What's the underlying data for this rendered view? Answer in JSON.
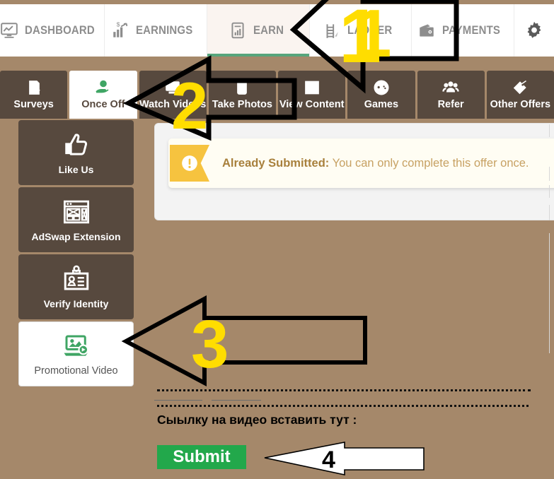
{
  "theme": {
    "page_bg": "#a5886a",
    "nav_bg": "#ffffff",
    "tab_active_bg": "#faf4f0",
    "tab_accent": "#56a57c",
    "subnav_bg": "#57493e",
    "sidebar_bg": "#57493e",
    "panel_bg": "#f3f3f3",
    "alert_bg": "#fffdf3",
    "alert_flag": "#f6c33f",
    "alert_title_color": "#a8803c",
    "alert_body_color": "#c7a163",
    "submit_bg": "#22a84b",
    "annotation_number_color": "#ffdd00",
    "annotation_outline_color": "#000000"
  },
  "topnav": {
    "items": [
      {
        "label": "DASHBOARD",
        "icon": "dashboard-chart-icon",
        "active": false
      },
      {
        "label": "EARNINGS",
        "icon": "earnings-bar-chart-icon",
        "active": false
      },
      {
        "label": "EARN",
        "icon": "earn-document-icon",
        "active": true
      },
      {
        "label": "LADDER",
        "icon": "ladder-icon",
        "active": false
      },
      {
        "label": "PAYMENTS",
        "icon": "wallet-icon",
        "active": false
      },
      {
        "label": "",
        "icon": "gear-icon",
        "active": false
      }
    ]
  },
  "subnav": {
    "items": [
      {
        "label": "Surveys",
        "icon": "survey-clipboard-icon",
        "active": false
      },
      {
        "label": "Once Off",
        "icon": "hand-coin-icon",
        "active": true
      },
      {
        "label": "Watch Videos",
        "icon": "watch-videos-icon",
        "active": false
      },
      {
        "label": "Take Photos",
        "icon": "camera-photo-icon",
        "active": false
      },
      {
        "label": "View Content",
        "icon": "view-content-icon",
        "active": false
      },
      {
        "label": "Games",
        "icon": "gamepad-icon",
        "active": false
      },
      {
        "label": "Refer",
        "icon": "people-group-icon",
        "active": false
      },
      {
        "label": "Other Offers",
        "icon": "price-tag-icon",
        "active": false
      }
    ]
  },
  "sidebar": {
    "items": [
      {
        "label": "Like Us",
        "icon": "thumbs-up-icon",
        "active": false
      },
      {
        "label": "AdSwap Extension",
        "icon": "browser-window-icon",
        "active": false
      },
      {
        "label": "Verify Identity",
        "icon": "id-badge-icon",
        "active": false
      },
      {
        "label": "Promotional Video",
        "icon": "video-laptop-icon",
        "active": true
      }
    ]
  },
  "alert": {
    "icon": "exclamation-circle-icon",
    "title": "Already Submitted:",
    "message": "You can only complete this offer once."
  },
  "form": {
    "label": "Сыылку на видео вставить тут :",
    "submit_label": "Submit"
  },
  "annotations": [
    {
      "number": "1",
      "style": "thick-outline",
      "number_color": "#ffdd00"
    },
    {
      "number": "2",
      "style": "thick-outline",
      "number_color": "#ffdd00"
    },
    {
      "number": "3",
      "style": "thick-outline",
      "number_color": "#ffdd00"
    },
    {
      "number": "4",
      "style": "thin-outline",
      "number_color": "#000000"
    }
  ]
}
